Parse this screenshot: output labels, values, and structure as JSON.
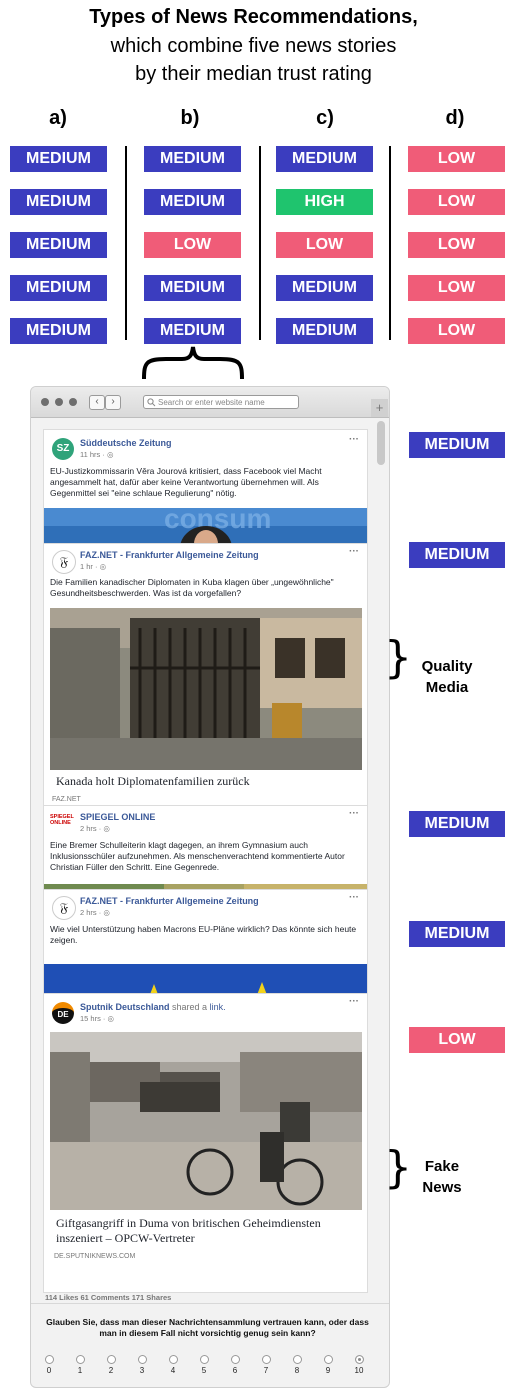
{
  "title_lines": [
    "Types of News Recommendations,",
    "which combine five news stories",
    "by their median trust rating"
  ],
  "columns": [
    {
      "label": "a)",
      "ratings": [
        "MEDIUM",
        "MEDIUM",
        "MEDIUM",
        "MEDIUM",
        "MEDIUM"
      ]
    },
    {
      "label": "b)",
      "ratings": [
        "MEDIUM",
        "MEDIUM",
        "LOW",
        "MEDIUM",
        "MEDIUM"
      ]
    },
    {
      "label": "c)",
      "ratings": [
        "MEDIUM",
        "HIGH",
        "LOW",
        "MEDIUM",
        "MEDIUM"
      ]
    },
    {
      "label": "d)",
      "ratings": [
        "LOW",
        "LOW",
        "LOW",
        "LOW",
        "LOW"
      ]
    }
  ],
  "colors": {
    "MEDIUM": "#3b3dbf",
    "LOW": "#f05c78",
    "HIGH": "#1fc46e"
  },
  "browser": {
    "url_placeholder": "Search or enter website name"
  },
  "posts": [
    {
      "source": "Süddeutsche Zeitung",
      "logo_text": "SZ",
      "time": "11 hrs · ◎",
      "text": "EU-Justizkommissarin Věra Jourová kritisiert, dass Facebook viel Macht angesammelt hat, dafür aber keine Verantwortung übernehmen will. Als Gegenmittel sei \"eine schlaue Regulierung\" nötig.",
      "rating": "MEDIUM"
    },
    {
      "source": "FAZ.NET - Frankfurter Allgemeine Zeitung",
      "logo_text": "𝔉",
      "time": "1 hr · ◎",
      "text": "Die Familien kanadischer Diplomaten in Kuba klagen über „ungewöhnliche\" Gesundheitsbeschwerden. Was ist da vorgefallen?",
      "headline": "Kanada holt Diplomatenfamilien zurück",
      "domain": "FAZ.NET",
      "rating": "MEDIUM"
    },
    {
      "source": "SPIEGEL ONLINE",
      "logo_text": "SPIEGEL ONLINE",
      "time": "2 hrs · ◎",
      "text": "Eine Bremer Schulleiterin klagt dagegen, an ihrem Gymnasium auch Inklusionsschüler aufzunehmen. Als menschenverachtend kommentierte Autor Christian Füller den Schritt. Eine Gegenrede.",
      "rating": "MEDIUM"
    },
    {
      "source": "FAZ.NET - Frankfurter Allgemeine Zeitung",
      "logo_text": "𝔉",
      "time": "2 hrs · ◎",
      "text": "Wie viel Unterstützung haben Macrons EU-Pläne wirklich? Das könnte sich heute zeigen.",
      "rating": "MEDIUM"
    },
    {
      "source": "Sputnik Deutschland",
      "shared": "shared a",
      "shared_link": "link.",
      "logo_text": "DE",
      "time": "15 hrs · ◎",
      "headline": "Giftgasangriff in Duma von britischen Geheimdiensten inszeniert – OPCW-Vertreter",
      "domain": "DE.SPUTNIKNEWS.COM",
      "rating": "LOW"
    }
  ],
  "engagement": "114 Likes  61 Comments  171 Shares",
  "question": "Glauben Sie, dass man dieser Nachrichtensammlung vertrauen kann, oder dass man in diesem Fall nicht vorsichtig genug sein kann?",
  "scale": [
    "0",
    "1",
    "2",
    "3",
    "4",
    "5",
    "6",
    "7",
    "8",
    "9",
    "10"
  ],
  "selected_scale_value": "10",
  "side_labels": {
    "quality": [
      "Quality",
      "Media"
    ],
    "fake": [
      "Fake",
      "News"
    ]
  },
  "more_icon": "more-dots-icon"
}
